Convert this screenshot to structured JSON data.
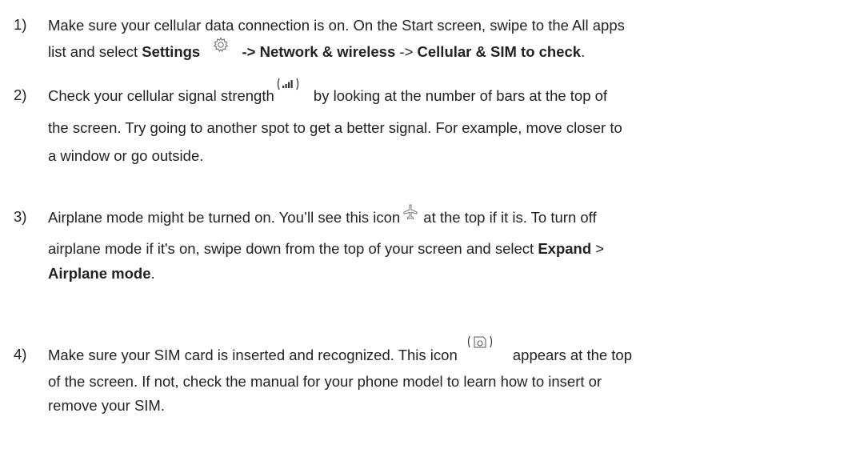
{
  "steps": [
    {
      "number": "1)",
      "line1": "Make sure your cellular data connection is on. On the Start screen, swipe to the All apps",
      "line2_a": "list and select ",
      "line2_settings": "Settings",
      "line2_b": " -> ",
      "line2_network": "Network & wireless",
      "line2_c": " -> ",
      "line2_cellular": "Cellular & SIM to check",
      "line2_end": "."
    },
    {
      "number": "2)",
      "line1_a": "Check your cellular signal strength",
      "line1_b": " by looking at the number of bars at the top of",
      "line2": "the screen. Try going to another spot to get a better signal. For example, move closer to",
      "line3": "a window or go outside."
    },
    {
      "number": "3)",
      "line1_a": "Airplane mode might be turned on. You’ll see this icon",
      "line1_b": " at the top if it is. To turn off",
      "line2_a": "airplane mode if it's on, swipe down from the top of your screen and select ",
      "line2_expand": "Expand",
      "line2_b": " >",
      "line3_airplane": "Airplane mode",
      "line3_end": "."
    },
    {
      "number": "4)",
      "line1_a": "Make sure your SIM card is inserted and recognized. This icon",
      "line1_b": " appears at the top",
      "line2": "of the screen. If not, check the manual for your phone model to learn how to insert or",
      "line3": "remove your SIM."
    }
  ],
  "icons": {
    "settings": "gear-icon",
    "signal": "signal-bars-icon",
    "airplane": "airplane-icon",
    "sim": "sim-card-icon"
  }
}
